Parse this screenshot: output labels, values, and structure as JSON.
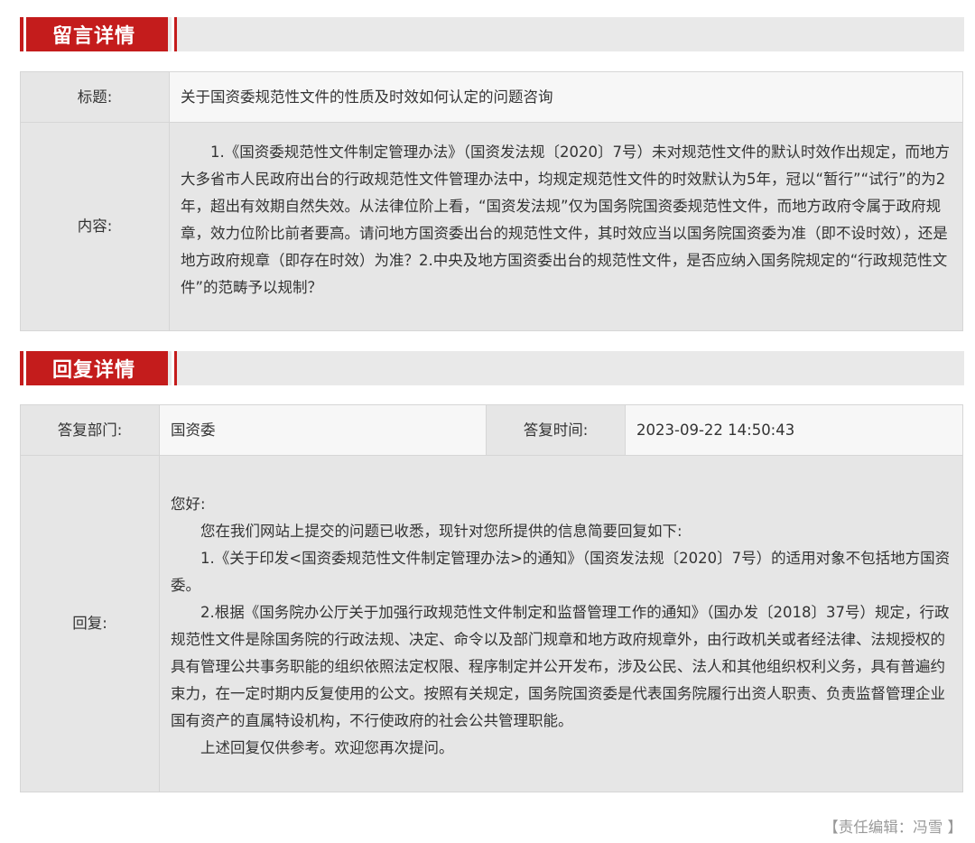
{
  "message_section": {
    "heading": "留言详情",
    "title_label": "标题:",
    "title_value": "关于国资委规范性文件的性质及时效如何认定的问题咨询",
    "content_label": "内容:",
    "content_text": "1.《国资委规范性文件制定管理办法》（国资发法规〔2020〕7号）未对规范性文件的默认时效作出规定，而地方大多省市人民政府出台的行政规范性文件管理办法中，均规定规范性文件的时效默认为5年，冠以“暂行”“试行”的为2年，超出有效期自然失效。从法律位阶上看，“国资发法规”仅为国务院国资委规范性文件，而地方政府令属于政府规章，效力位阶比前者要高。请问地方国资委出台的规范性文件，其时效应当以国务院国资委为准（即不设时效），还是地方政府规章（即存在时效）为准？2.中央及地方国资委出台的规范性文件，是否应纳入国务院规定的“行政规范性文件”的范畴予以规制？"
  },
  "reply_section": {
    "heading": "回复详情",
    "dept_label": "答复部门:",
    "dept_value": "国资委",
    "time_label": "答复时间:",
    "time_value": "2023-09-22 14:50:43",
    "reply_label": "回复:",
    "greeting": "您好:",
    "paragraphs": [
      "您在我们网站上提交的问题已收悉，现针对您所提供的信息简要回复如下:",
      "1.《关于印发<国资委规范性文件制定管理办法>的通知》（国资发法规〔2020〕7号）的适用对象不包括地方国资委。",
      "2.根据《国务院办公厅关于加强行政规范性文件制定和监督管理工作的通知》（国办发〔2018〕37号）规定，行政规范性文件是除国务院的行政法规、决定、命令以及部门规章和地方政府规章外，由行政机关或者经法律、法规授权的具有管理公共事务职能的组织依照法定权限、程序制定并公开发布，涉及公民、法人和其他组织权利义务，具有普遍约束力，在一定时期内反复使用的公文。按照有关规定，国务院国资委是代表国务院履行出资人职责、负责监督管理企业国有资产的直属特设机构，不行使政府的社会公共管理职能。",
      "上述回复仅供参考。欢迎您再次提问。"
    ]
  },
  "footer": {
    "editor": "【责任编辑：冯雪 】"
  },
  "colors": {
    "accent_red": "#c41c1c",
    "header_bar": "#e9e9e9",
    "label_bg": "#e6e6e6",
    "value_bg": "#f7f7f7",
    "muted_text": "#999999"
  }
}
